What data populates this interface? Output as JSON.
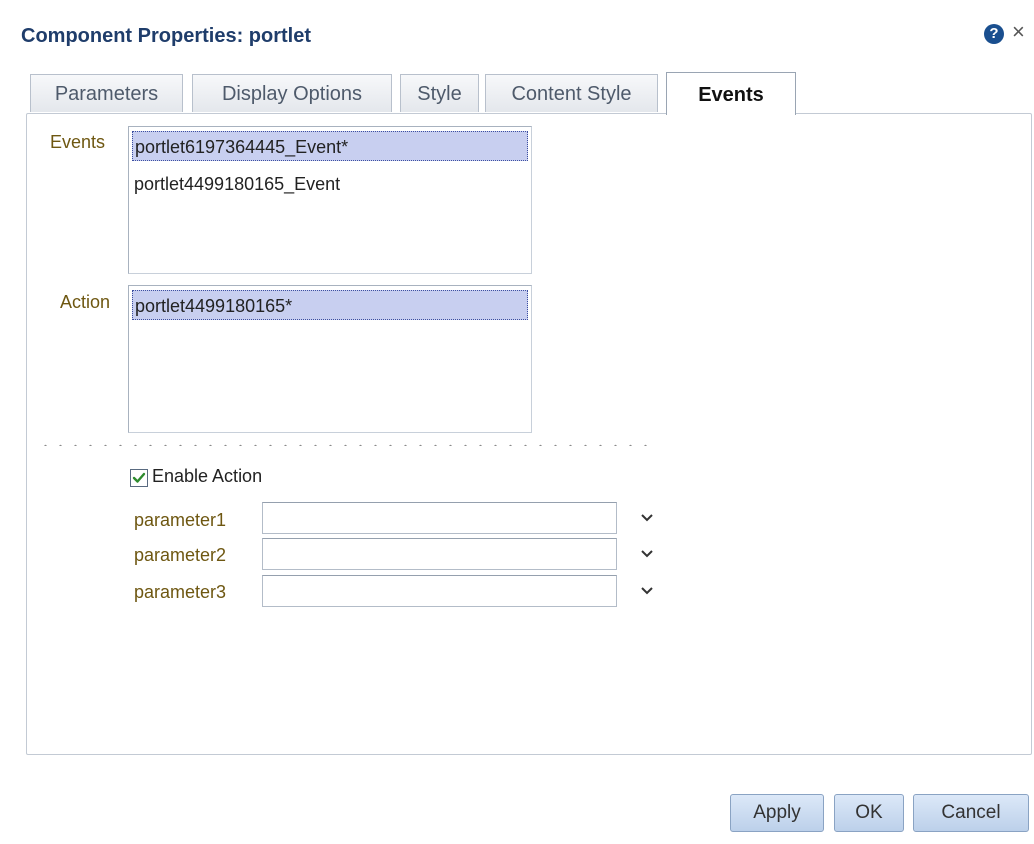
{
  "dialog": {
    "title": "Component Properties: portlet",
    "help_icon": "question-circle-icon",
    "close_icon": "close-icon",
    "close_glyph": "×",
    "help_glyph": "?"
  },
  "tabs": [
    {
      "label": "Parameters",
      "active": false
    },
    {
      "label": "Display Options",
      "active": false
    },
    {
      "label": "Style",
      "active": false
    },
    {
      "label": "Content Style",
      "active": false
    },
    {
      "label": "Events",
      "active": true
    }
  ],
  "events": {
    "label": "Events",
    "items": [
      "portlet6197364445_Event*",
      "portlet4499180165_Event"
    ],
    "selected_index": 0
  },
  "action": {
    "label": "Action",
    "items": [
      "portlet4499180165*"
    ],
    "selected_index": 0
  },
  "enable_action": {
    "label": "Enable Action",
    "checked": true
  },
  "parameters": [
    {
      "label": "parameter1",
      "value": ""
    },
    {
      "label": "parameter2",
      "value": ""
    },
    {
      "label": "parameter3",
      "value": ""
    }
  ],
  "buttons": {
    "apply": "Apply",
    "ok": "OK",
    "cancel": "Cancel"
  },
  "colors": {
    "title": "#1f3d6b",
    "label_gold": "#6e5711",
    "selection": "#c8cff0",
    "button": "#c9daf0",
    "check": "#2e8b2e"
  }
}
